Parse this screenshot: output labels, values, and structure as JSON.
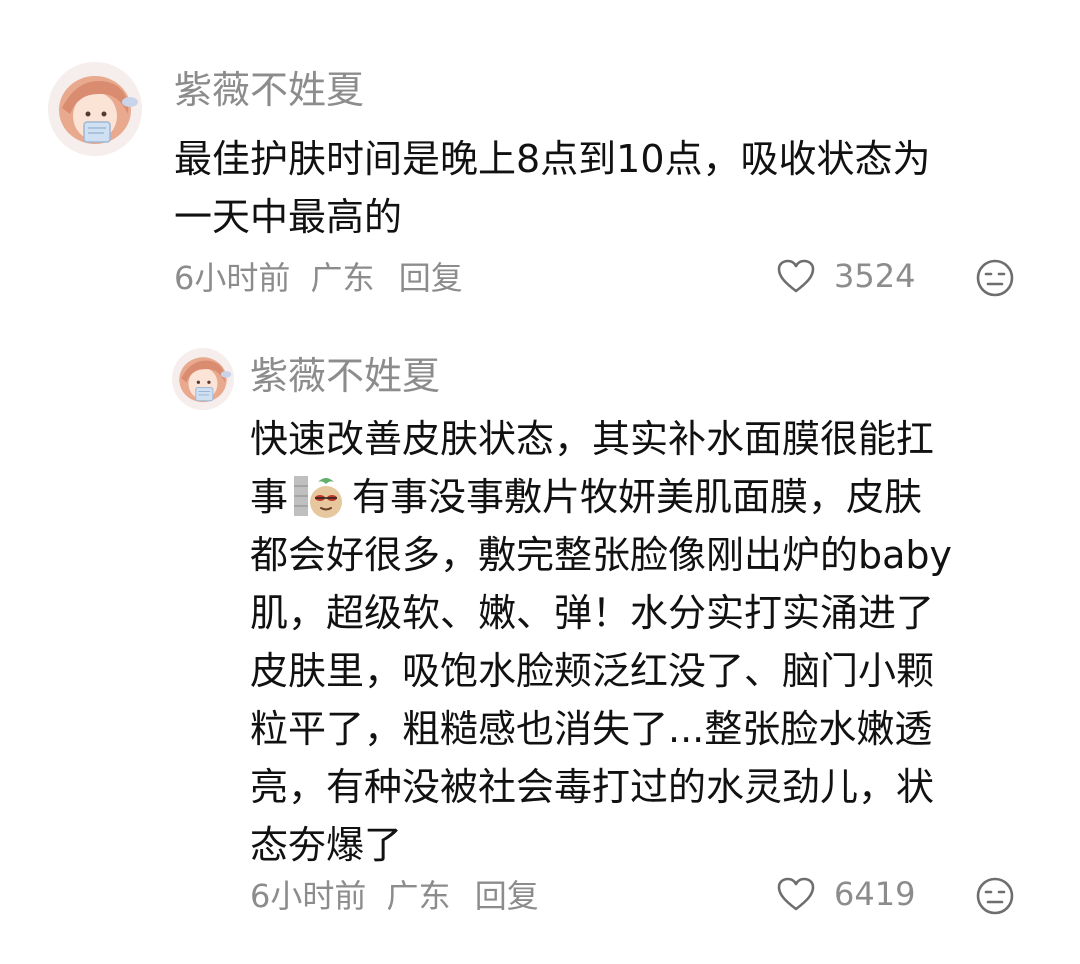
{
  "comments": [
    {
      "username": "紫薇不姓夏",
      "text_lines": [
        "最佳护肤时间是晚上8点到10点，吸收状态为",
        "一天中最高的"
      ],
      "time": "6小时前",
      "location": "广东",
      "reply_label": "回复",
      "likes": "3524"
    }
  ],
  "reply": {
    "username": "紫薇不姓夏",
    "line1": "快速改善皮肤状态，其实补水面膜很能扛",
    "line2_before_emoji": "事",
    "emoji": "sticker-emoji",
    "line2_after_emoji": "有事没事敷片牧妍美肌面膜，皮肤",
    "line3": "都会好很多，敷完整张脸像刚出炉的baby",
    "line4": "肌，超级软、嫩、弹！水分实打实涌进了",
    "line5": "皮肤里，吸饱水脸颊泛红没了、脑门小颗",
    "line6": "粒平了，粗糙感也消失了...整张脸水嫩透",
    "line7": "亮，有种没被社会毒打过的水灵劲儿，状",
    "line8": "态夯爆了",
    "time": "6小时前",
    "location": "广东",
    "reply_label": "回复",
    "likes": "6419"
  },
  "icons": {
    "like": "heart-outline-icon",
    "dislike": "dislike-face-icon",
    "avatar": "anime-girl-avatar"
  },
  "colors": {
    "text": "#111111",
    "secondary": "#8c8c8c",
    "background": "#ffffff"
  }
}
